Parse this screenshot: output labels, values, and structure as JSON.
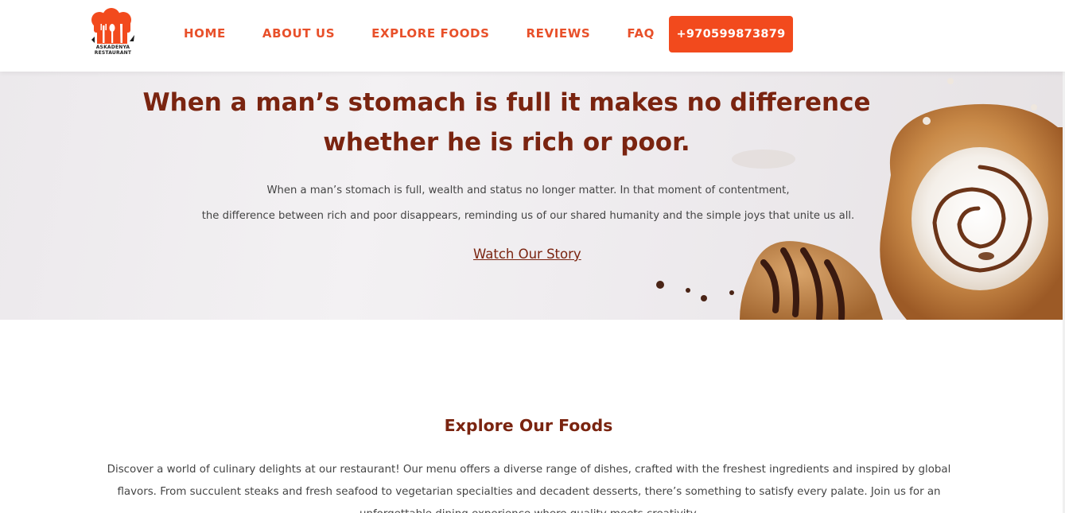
{
  "header": {
    "logo_text_line1": "ASKADENYA",
    "logo_text_line2": "RESTAURANT",
    "nav": {
      "home": "HOME",
      "about": "ABOUT US",
      "explore": "EXPLORE FOODS",
      "reviews": "REVIEWS",
      "faq": "FAQ"
    },
    "phone_label": "+970599873879"
  },
  "hero": {
    "title": "When a man’s stomach is full it makes no difference whether he is rich or poor.",
    "description_line1": "When a man’s stomach is full, wealth and status no longer matter. In that moment of contentment,",
    "description_line2": "the difference between rich and poor disappears, reminding us of our shared humanity and the simple joys that unite us all.",
    "link_label": "Watch Our Story",
    "image": "cinnamon-roll-pastry-image"
  },
  "explore": {
    "title": "Explore Our Foods",
    "text": "Discover a world of culinary delights at our restaurant! Our menu offers a diverse range of dishes, crafted with the freshest ingredients and inspired by global flavors. From succulent steaks and fresh seafood to vegetarian specialties and decadent desserts, there’s something to satisfy every palate. Join us for an unforgettable dining experience where quality meets creativity."
  },
  "colors": {
    "accent": "#f24a1d",
    "nav_text": "#e8502a",
    "heading": "#7a2410"
  }
}
